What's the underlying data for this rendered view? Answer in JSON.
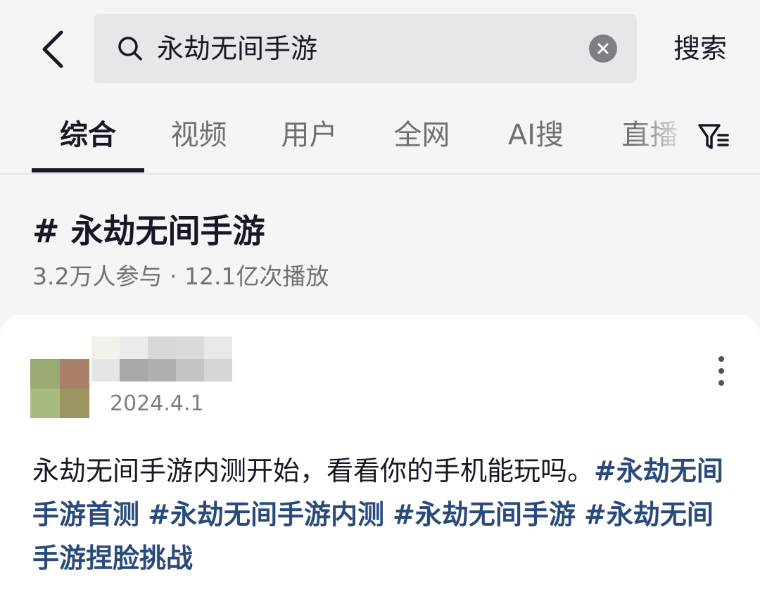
{
  "search": {
    "query": "永劫无间手游",
    "submit_label": "搜索"
  },
  "tabs": [
    {
      "label": "综合",
      "active": true
    },
    {
      "label": "视频",
      "active": false
    },
    {
      "label": "用户",
      "active": false
    },
    {
      "label": "全网",
      "active": false
    },
    {
      "label": "AI搜",
      "active": false
    },
    {
      "label": "直播",
      "active": false
    }
  ],
  "hashtag": {
    "title": "# 永劫无间手游",
    "stats": "3.2万人参与 · 12.1亿次播放"
  },
  "post": {
    "date": "2024.4.1",
    "text": "永劫无间手游内测开始，看看你的手机能玩吗。",
    "tags": [
      "#永劫无间手游首测",
      "#永劫无间手游内测",
      "#永劫无间手游",
      "#永劫无间手游捏脸挑战"
    ]
  },
  "icons": {
    "back": "back-chevron-icon",
    "search": "search-icon",
    "clear": "clear-icon",
    "filter": "filter-icon",
    "more": "more-vertical-icon"
  },
  "colors": {
    "background": "#f4f5f7",
    "card": "#ffffff",
    "text_primary": "#161823",
    "text_secondary": "#6f7076",
    "hashtag_link": "#2a4a7c"
  }
}
